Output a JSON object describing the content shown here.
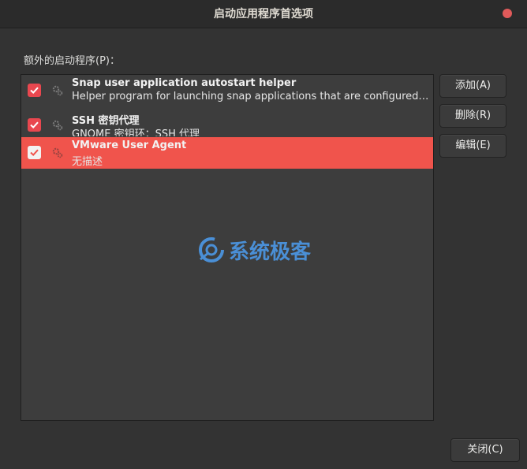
{
  "window": {
    "title": "启动应用程序首选项",
    "accent_color": "#f0544c"
  },
  "list": {
    "label": "额外的启动程序(P)：",
    "items": [
      {
        "name": "Snap user application autostart helper",
        "description": "Helper program for launching snap applications that are configured to start automatically.",
        "checked": true,
        "selected": false,
        "icon": "gears-icon"
      },
      {
        "name": "SSH 密钥代理",
        "description": "GNOME 密钥环：SSH 代理",
        "checked": true,
        "selected": false,
        "icon": "gears-icon"
      },
      {
        "name": "VMware User Agent",
        "description": "无描述",
        "checked": true,
        "selected": true,
        "icon": "gears-icon"
      }
    ]
  },
  "buttons": {
    "add": "添加(A)",
    "remove": "删除(R)",
    "edit": "编辑(E)",
    "close": "关闭(C)"
  },
  "watermark": {
    "text": "系统极客"
  }
}
